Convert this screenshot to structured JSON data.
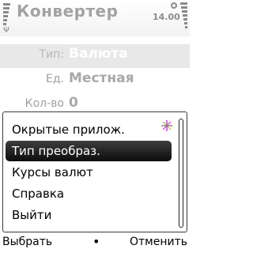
{
  "status": {
    "title": "Конвертер",
    "clock": "14.00",
    "signal_icon": "signal-bars-icon",
    "battery_icon": "battery-bars-icon"
  },
  "form": {
    "fields": [
      {
        "label": "Тип:",
        "value": "Валюта"
      },
      {
        "label": "Ед.",
        "value": "Местная"
      },
      {
        "label": "Кол-во",
        "value": "0"
      }
    ]
  },
  "menu": {
    "items": [
      {
        "label": "Окрытые прилож."
      },
      {
        "label": "Тип преобраз."
      },
      {
        "label": "Курсы валют"
      },
      {
        "label": "Справка"
      },
      {
        "label": "Выйти"
      }
    ],
    "selected_index": 1,
    "indicator_icon": "sparkle-icon"
  },
  "softkeys": {
    "left": "Выбрать",
    "middle": "•",
    "right": "Отменить"
  }
}
